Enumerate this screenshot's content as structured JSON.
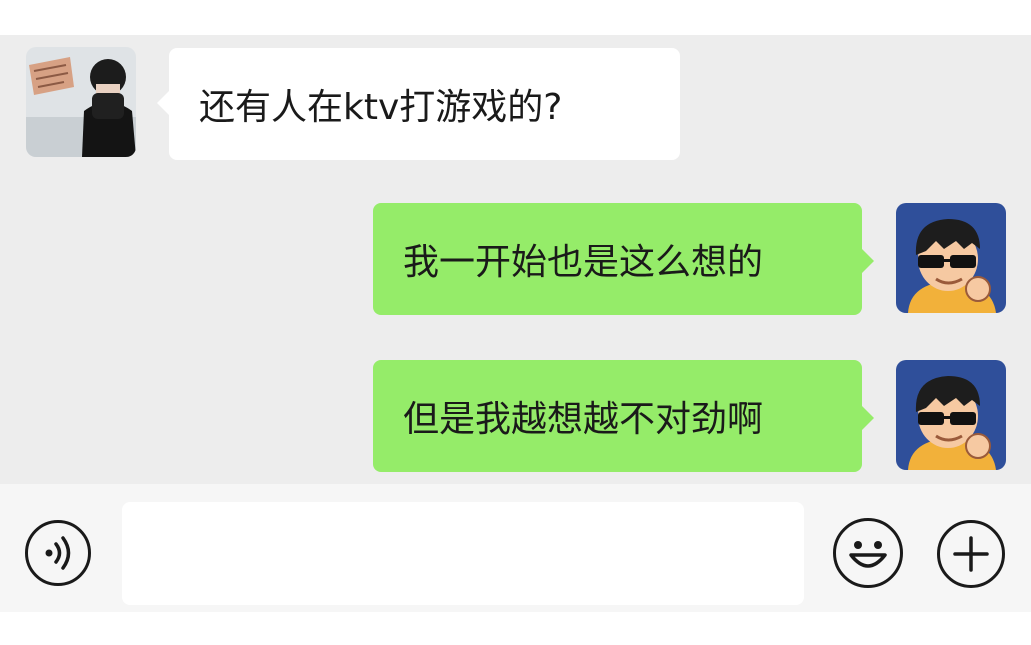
{
  "conversation": {
    "messages": [
      {
        "side": "received",
        "text": "还有人在ktv打游戏的?",
        "avatar": "hooded-person-photo"
      },
      {
        "side": "sent",
        "text": "我一开始也是这么想的",
        "avatar": "cartoon-sunglasses-man"
      },
      {
        "side": "sent",
        "text": "但是我越想越不对劲啊",
        "avatar": "cartoon-sunglasses-man"
      }
    ]
  },
  "input_bar": {
    "voice_icon": "voice-input-icon",
    "emoji_icon": "emoji-icon",
    "more_icon": "plus-icon",
    "input_value": ""
  },
  "colors": {
    "chat_background": "#ededed",
    "sent_bubble": "#95ec69",
    "received_bubble": "#ffffff",
    "input_bar_background": "#f6f6f6"
  }
}
